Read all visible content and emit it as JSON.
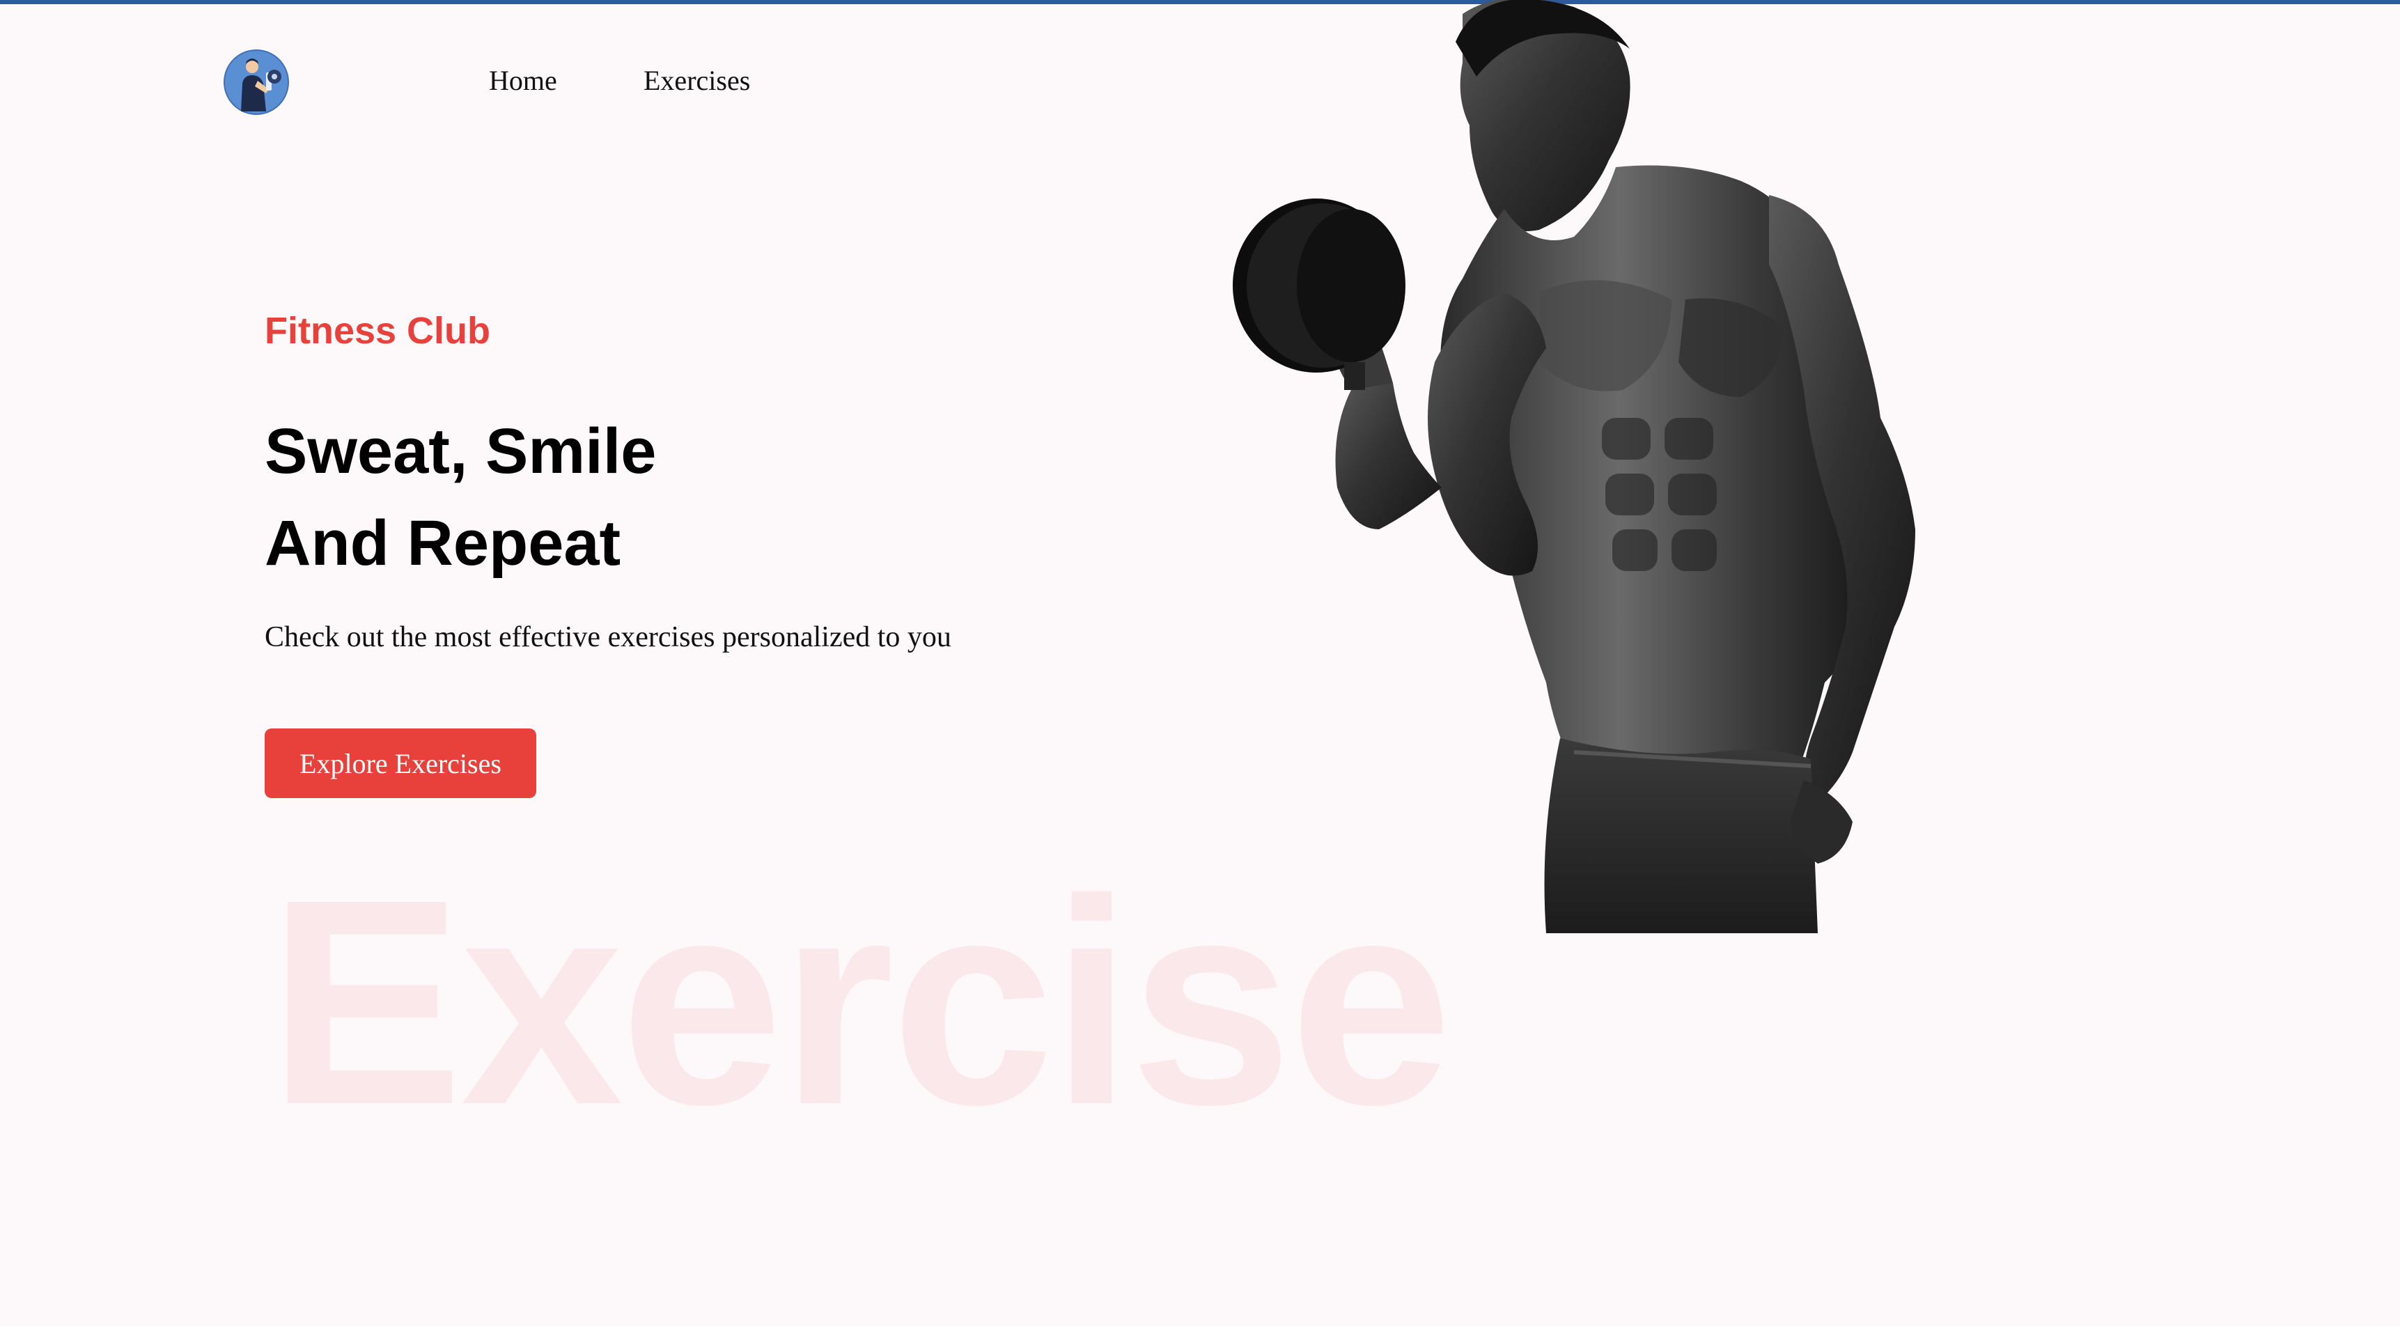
{
  "nav": {
    "logo_icon": "fitness-logo-icon",
    "items": [
      {
        "label": "Home"
      },
      {
        "label": "Exercises"
      }
    ]
  },
  "hero": {
    "eyebrow": "Fitness Club",
    "headline_line1": "Sweat, Smile",
    "headline_line2": "And Repeat",
    "subtext": "Check out the most effective exercises personalized to you",
    "cta_label": "Explore Exercises",
    "watermark": "Exercise",
    "image_icon": "bodybuilder-dumbbell-image"
  },
  "colors": {
    "accent": "#e8403a",
    "background": "#fdf9fa",
    "top_bar": "#2e5a9a",
    "watermark": "#fbe8ea"
  }
}
